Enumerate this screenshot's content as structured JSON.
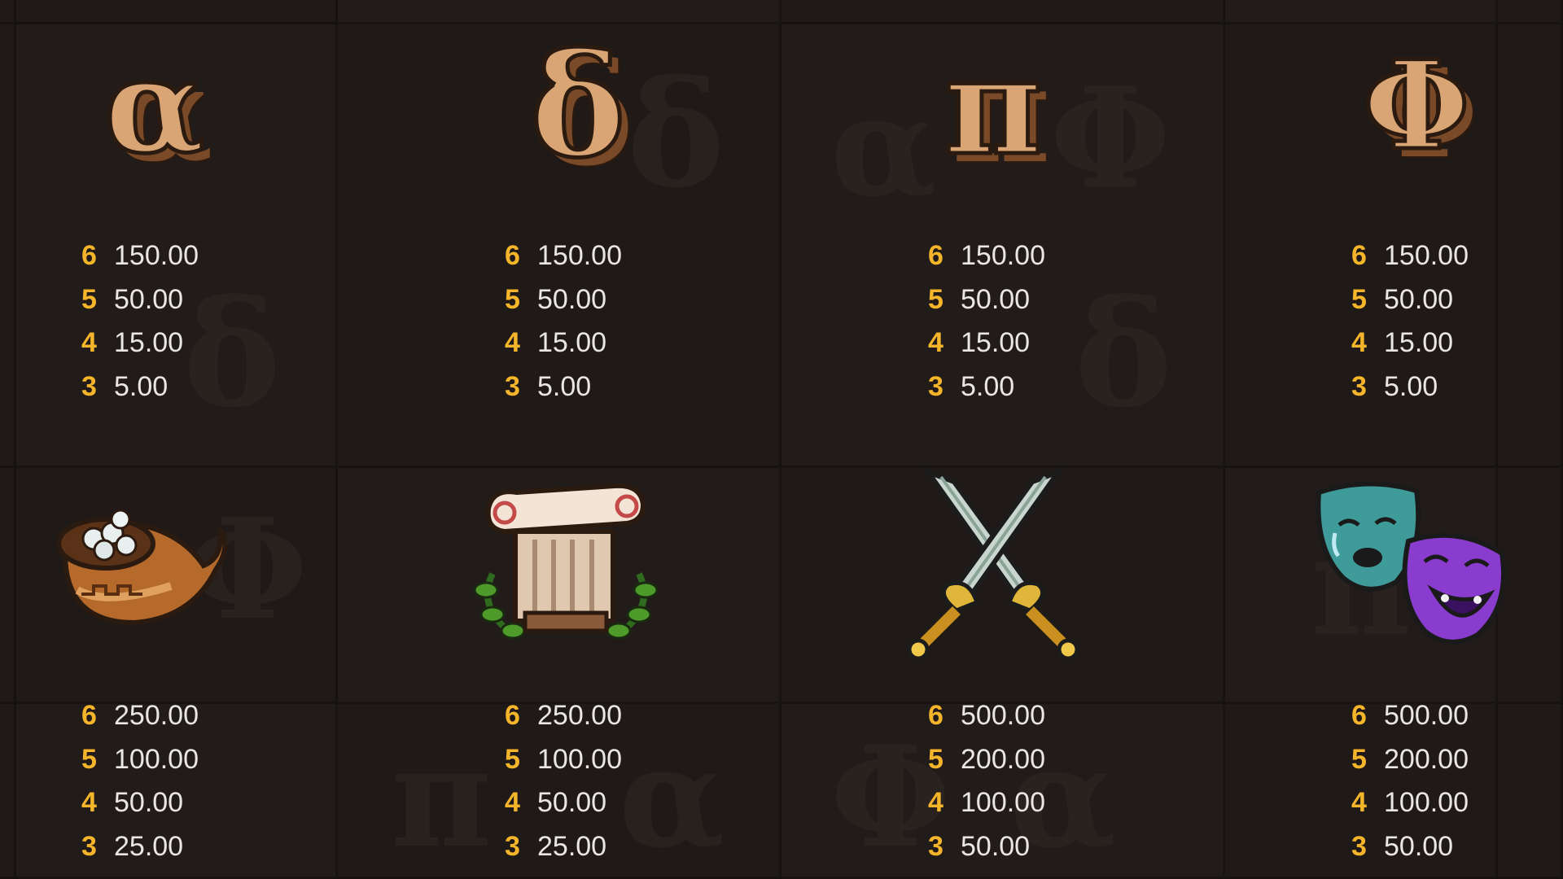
{
  "paytable": [
    {
      "symbol": "alpha",
      "glyph": "α",
      "pays": [
        {
          "count": "6",
          "value": "150.00"
        },
        {
          "count": "5",
          "value": "50.00"
        },
        {
          "count": "4",
          "value": "15.00"
        },
        {
          "count": "3",
          "value": "5.00"
        }
      ]
    },
    {
      "symbol": "delta",
      "glyph": "δ",
      "pays": [
        {
          "count": "6",
          "value": "150.00"
        },
        {
          "count": "5",
          "value": "50.00"
        },
        {
          "count": "4",
          "value": "15.00"
        },
        {
          "count": "3",
          "value": "5.00"
        }
      ]
    },
    {
      "symbol": "pi",
      "glyph": "π",
      "pays": [
        {
          "count": "6",
          "value": "150.00"
        },
        {
          "count": "5",
          "value": "50.00"
        },
        {
          "count": "4",
          "value": "15.00"
        },
        {
          "count": "3",
          "value": "5.00"
        }
      ]
    },
    {
      "symbol": "phi",
      "glyph": "Φ",
      "pays": [
        {
          "count": "6",
          "value": "150.00"
        },
        {
          "count": "5",
          "value": "50.00"
        },
        {
          "count": "4",
          "value": "15.00"
        },
        {
          "count": "3",
          "value": "5.00"
        }
      ]
    },
    {
      "symbol": "cornucopia-icon",
      "pays": [
        {
          "count": "6",
          "value": "250.00"
        },
        {
          "count": "5",
          "value": "100.00"
        },
        {
          "count": "4",
          "value": "50.00"
        },
        {
          "count": "3",
          "value": "25.00"
        }
      ]
    },
    {
      "symbol": "column-icon",
      "pays": [
        {
          "count": "6",
          "value": "250.00"
        },
        {
          "count": "5",
          "value": "100.00"
        },
        {
          "count": "4",
          "value": "50.00"
        },
        {
          "count": "3",
          "value": "25.00"
        }
      ]
    },
    {
      "symbol": "crossed-swords-icon",
      "pays": [
        {
          "count": "6",
          "value": "500.00"
        },
        {
          "count": "5",
          "value": "200.00"
        },
        {
          "count": "4",
          "value": "100.00"
        },
        {
          "count": "3",
          "value": "50.00"
        }
      ]
    },
    {
      "symbol": "theater-masks-icon",
      "pays": [
        {
          "count": "6",
          "value": "500.00"
        },
        {
          "count": "5",
          "value": "200.00"
        },
        {
          "count": "4",
          "value": "100.00"
        },
        {
          "count": "3",
          "value": "50.00"
        }
      ]
    }
  ],
  "colors": {
    "count": "#f5b52a",
    "value": "#e9e6e3",
    "background": "#1c1716",
    "letter_fill": "#d9a574",
    "letter_shadow": "#7a4a28"
  }
}
